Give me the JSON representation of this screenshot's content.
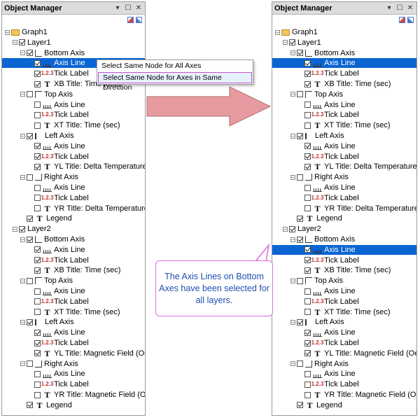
{
  "panel_title": "Object Manager",
  "window_buttons": {
    "pin": "▾",
    "float": "☐",
    "close": "✕"
  },
  "tree": [
    {
      "label": "Graph1",
      "icon": "folder",
      "level": 0,
      "expander": "−"
    },
    {
      "label": "Layer1",
      "icon": "none",
      "level": 1,
      "expander": "−",
      "check": true
    },
    {
      "label": "Bottom Axis",
      "icon": "frame",
      "level": 2,
      "expander": "−",
      "check": true
    },
    {
      "label": "Axis Line",
      "icon": "axis",
      "level": 3,
      "check": true,
      "selected": true
    },
    {
      "label": "Tick Label",
      "icon": "tick",
      "level": 3,
      "check": true
    },
    {
      "label": "XB Title: Time (sec)",
      "icon": "text",
      "level": 3,
      "check": true
    },
    {
      "label": "Top Axis",
      "icon": "frame-top",
      "level": 2,
      "expander": "−",
      "check": false
    },
    {
      "label": "Axis Line",
      "icon": "axis",
      "level": 3,
      "check": false
    },
    {
      "label": "Tick Label",
      "icon": "tick",
      "level": 3,
      "check": false
    },
    {
      "label": "XT Title: Time (sec)",
      "icon": "text",
      "level": 3,
      "check": false
    },
    {
      "label": "Left Axis",
      "icon": "frame-left",
      "level": 2,
      "expander": "−",
      "check": true
    },
    {
      "label": "Axis Line",
      "icon": "axis",
      "level": 3,
      "check": true
    },
    {
      "label": "Tick Label",
      "icon": "tick",
      "level": 3,
      "check": true
    },
    {
      "label": "YL Title: Delta Temperature (K",
      "icon": "text",
      "level": 3,
      "check": true
    },
    {
      "label": "Right Axis",
      "icon": "frame-right",
      "level": 2,
      "expander": "−",
      "check": false
    },
    {
      "label": "Axis Line",
      "icon": "axis",
      "level": 3,
      "check": false
    },
    {
      "label": "Tick Label",
      "icon": "tick",
      "level": 3,
      "check": false
    },
    {
      "label": "YR Title: Delta Temperature (K",
      "icon": "text",
      "level": 3,
      "check": false
    },
    {
      "label": "Legend",
      "icon": "text",
      "level": 2,
      "check": true
    },
    {
      "label": "Layer2",
      "icon": "none",
      "level": 1,
      "expander": "−",
      "check": true
    },
    {
      "label": "Bottom Axis",
      "icon": "frame",
      "level": 2,
      "expander": "−",
      "check": true
    },
    {
      "label": "Axis Line",
      "icon": "axis",
      "level": 3,
      "check": true
    },
    {
      "label": "Tick Label",
      "icon": "tick",
      "level": 3,
      "check": true
    },
    {
      "label": "XB Title: Time (sec)",
      "icon": "text",
      "level": 3,
      "check": true
    },
    {
      "label": "Top Axis",
      "icon": "frame-top",
      "level": 2,
      "expander": "−",
      "check": false
    },
    {
      "label": "Axis Line",
      "icon": "axis",
      "level": 3,
      "check": false
    },
    {
      "label": "Tick Label",
      "icon": "tick",
      "level": 3,
      "check": false
    },
    {
      "label": "XT Title: Time (sec)",
      "icon": "text",
      "level": 3,
      "check": false
    },
    {
      "label": "Left Axis",
      "icon": "frame-left",
      "level": 2,
      "expander": "−",
      "check": true
    },
    {
      "label": "Axis Line",
      "icon": "axis",
      "level": 3,
      "check": true
    },
    {
      "label": "Tick Label",
      "icon": "tick",
      "level": 3,
      "check": true
    },
    {
      "label": "YL Title: Magnetic Field (Oe)",
      "icon": "text",
      "level": 3,
      "check": true
    },
    {
      "label": "Right Axis",
      "icon": "frame-right",
      "level": 2,
      "expander": "−",
      "check": false
    },
    {
      "label": "Axis Line",
      "icon": "axis",
      "level": 3,
      "check": false
    },
    {
      "label": "Tick Label",
      "icon": "tick",
      "level": 3,
      "check": false
    },
    {
      "label": "YR Title: Magnetic Field (Oe)",
      "icon": "text",
      "level": 3,
      "check": false
    },
    {
      "label": "Legend",
      "icon": "text",
      "level": 2,
      "check": true
    }
  ],
  "right_selected_rows": [
    3,
    21
  ],
  "context_menu": [
    {
      "label": "Select Same Node for All Axes",
      "highlighted": false
    },
    {
      "label": "Select Same Node for Axes in Same Direction",
      "highlighted": true
    }
  ],
  "callout_text": "The Axis Lines on Bottom Axes have been selected for all layers.",
  "colors": {
    "selection": "#0a64d2",
    "arrow": "#e79a9f",
    "callout_border": "#e06be0",
    "callout_text": "#1f4fb2"
  }
}
